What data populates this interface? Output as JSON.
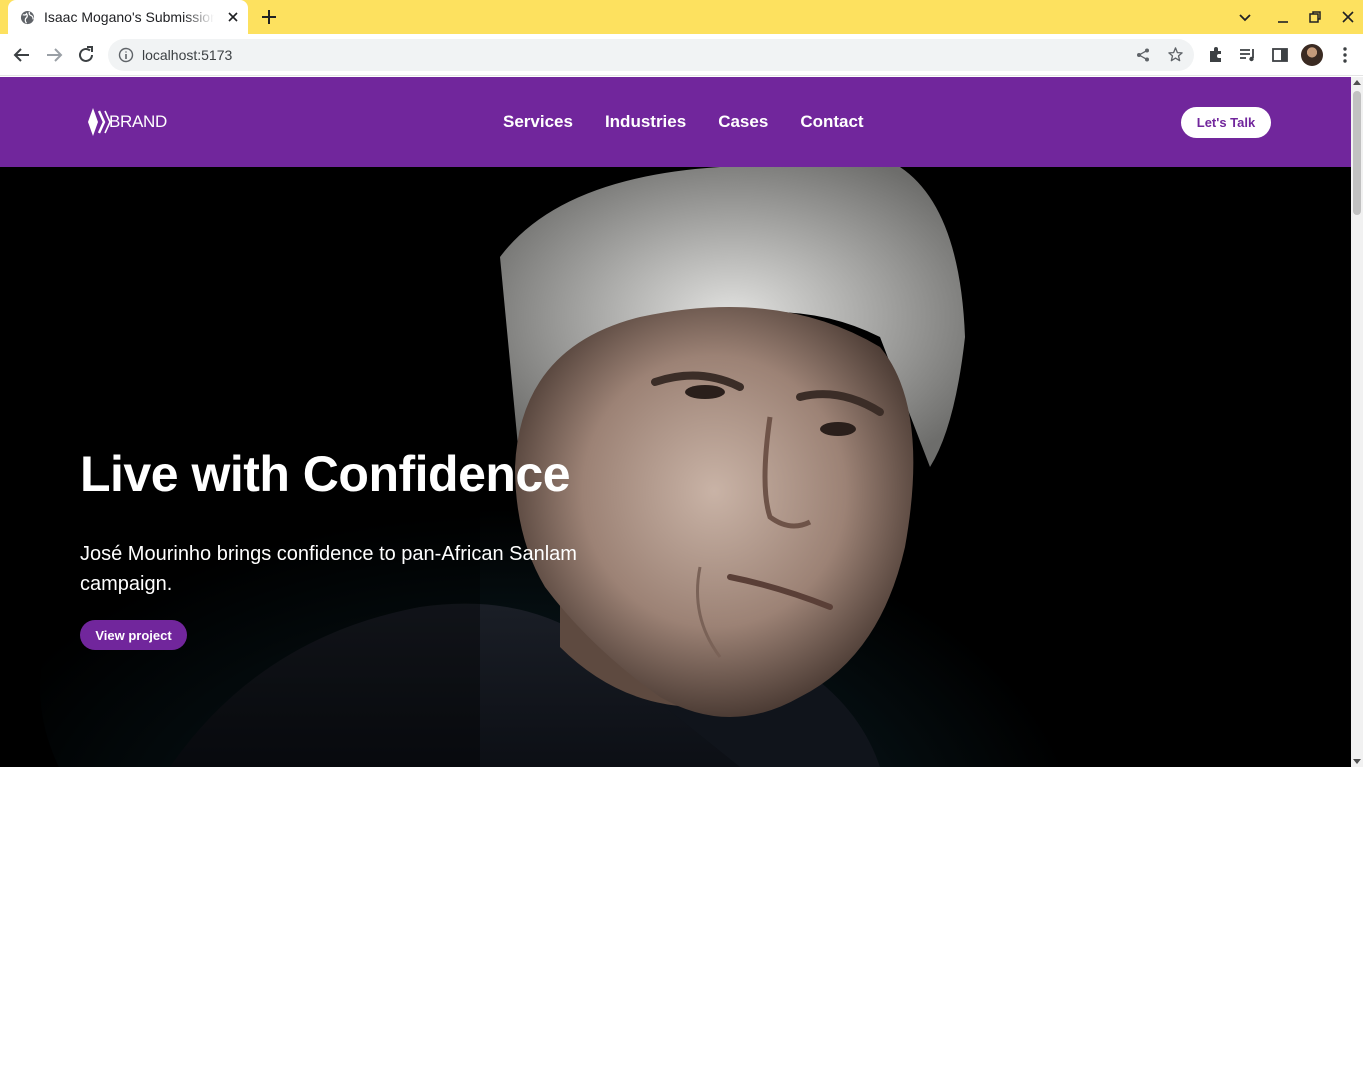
{
  "browser": {
    "tab_title": "Isaac Mogano's Submission",
    "url": "localhost:5173",
    "icons": [
      "globe-icon",
      "close-icon",
      "plus-icon",
      "chevron-down-icon",
      "minimize-icon",
      "restore-icon",
      "back-icon",
      "forward-icon",
      "reload-icon",
      "info-icon",
      "share-icon",
      "star-icon",
      "extensions-icon",
      "media-icon",
      "side-panel-icon",
      "more-icon"
    ],
    "tab_bar_color": "#fde15f"
  },
  "site": {
    "logo_text": "BRAND",
    "nav": [
      "Services",
      "Industries",
      "Cases",
      "Contact"
    ],
    "cta_label": "Let's Talk",
    "brand_color": "#71269c"
  },
  "hero": {
    "title": "Live with Confidence",
    "subtitle": "José Mourinho brings confidence to pan-African Sanlam campaign.",
    "button_label": "View project"
  }
}
